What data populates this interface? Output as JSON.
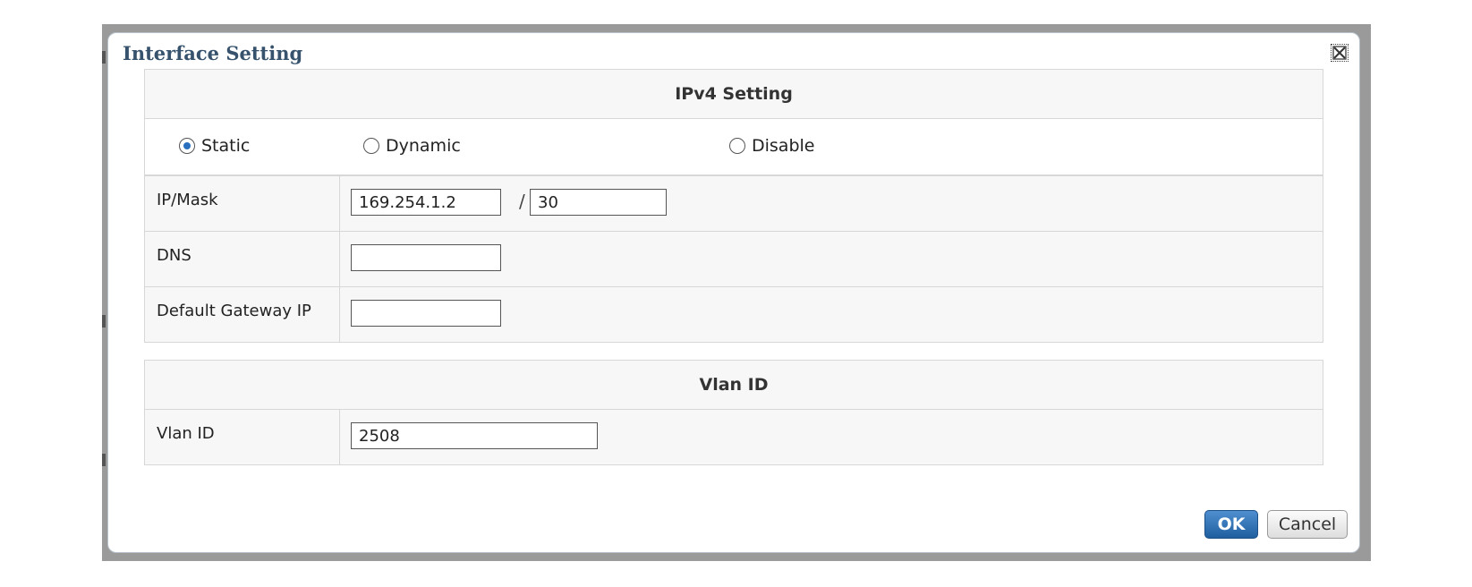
{
  "dialog": {
    "title": "Interface Setting"
  },
  "ipv4": {
    "header": "IPv4 Setting",
    "modes": [
      {
        "label": "Static",
        "selected": true
      },
      {
        "label": "Dynamic",
        "selected": false
      },
      {
        "label": "Disable",
        "selected": false
      }
    ],
    "ip_mask_label": "IP/Mask",
    "ip_value": "169.254.1.2",
    "mask_separator": "/",
    "mask_value": "30",
    "dns_label": "DNS",
    "dns_value": "",
    "gateway_label": "Default Gateway IP",
    "gateway_value": ""
  },
  "vlan": {
    "header": "Vlan ID",
    "label": "Vlan ID",
    "value": "2508"
  },
  "buttons": {
    "ok": "OK",
    "cancel": "Cancel"
  },
  "colors": {
    "title": "#36526d",
    "ok_button": "#2a6fbf",
    "radio_selected": "#2a6fbf"
  }
}
